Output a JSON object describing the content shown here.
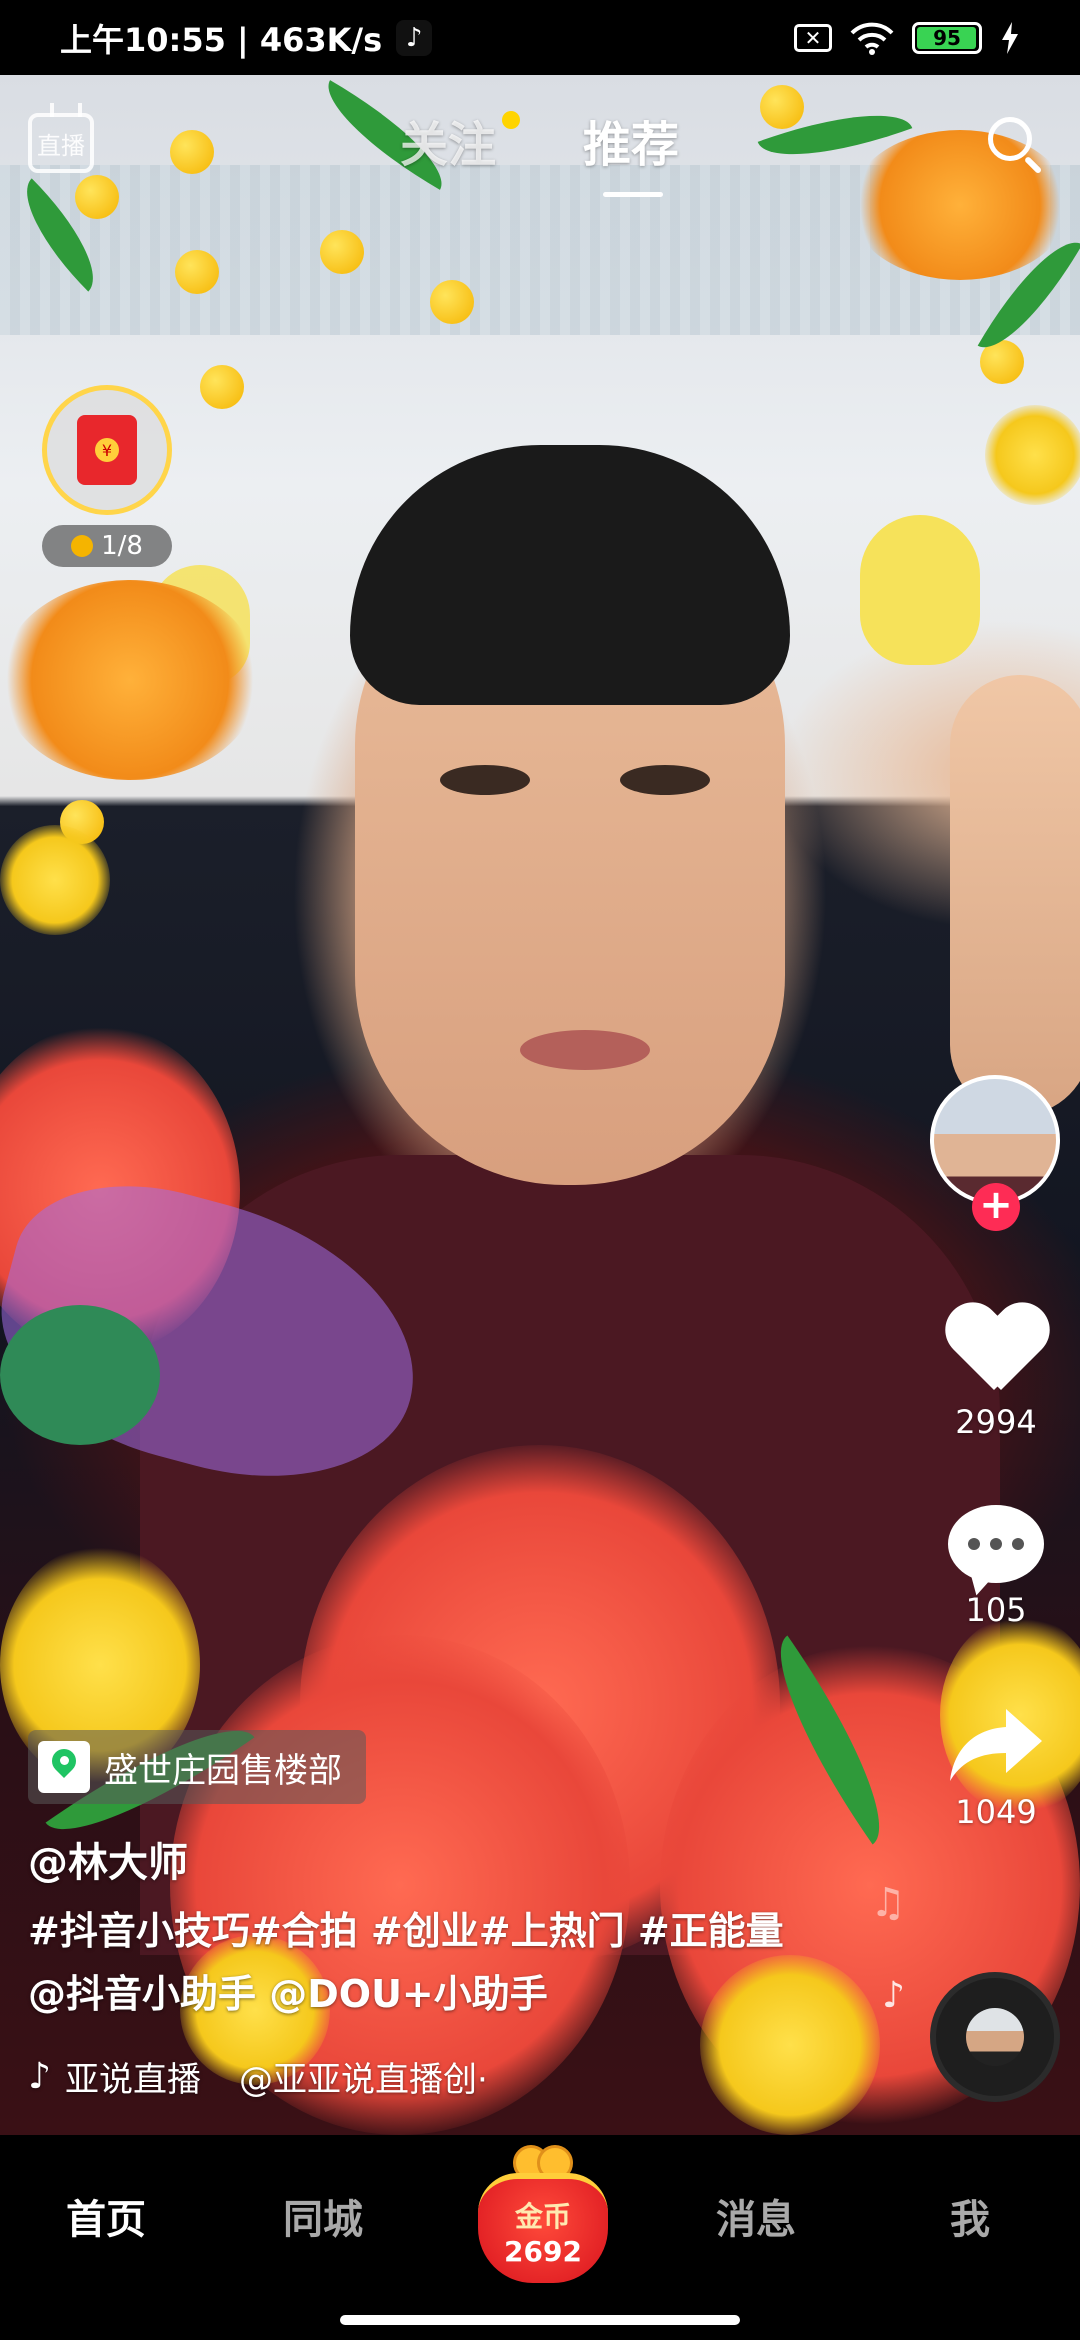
{
  "status_bar": {
    "time_speed": "上午10:55 | 463K/s",
    "battery": "95"
  },
  "top_nav": {
    "live_label": "直播",
    "tab_follow": "关注",
    "tab_recommend": "推荐"
  },
  "red_packet": {
    "progress": "1/8"
  },
  "right_rail": {
    "likes": "2994",
    "comments": "105",
    "shares": "1049"
  },
  "video_info": {
    "location": "盛世庄园售楼部",
    "author": "@林大师",
    "caption": "#抖音小技巧#合拍 #创业#上热门 #正能量@抖音小助手 @DOU+小助手",
    "music_1": "亚说直播",
    "music_2": "@亚亚说直播创·"
  },
  "bottom_nav": {
    "home": "首页",
    "city": "同城",
    "coin_label": "金币",
    "coin_count": "2692",
    "messages": "消息",
    "me": "我"
  },
  "colors": {
    "accent_red": "#fe2c55",
    "battery_green": "#39d353",
    "location_green": "#1fc463",
    "gold": "#ffd54a"
  }
}
